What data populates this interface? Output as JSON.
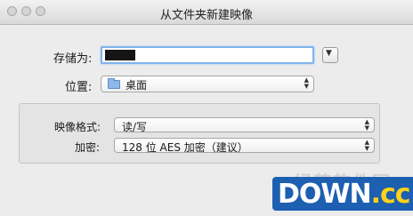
{
  "window": {
    "title": "从文件夹新建映像"
  },
  "save_as": {
    "label": "存储为:",
    "value": ""
  },
  "location": {
    "label": "位置:",
    "value": "桌面"
  },
  "image_format": {
    "label": "映像格式:",
    "value": "读/写"
  },
  "encryption": {
    "label": "加密:",
    "value": "128 位 AES 加密（建议）"
  },
  "watermark": {
    "cn": "绿茶软件园",
    "brand": "DOWN",
    "suffix": ".cc"
  },
  "icons": {
    "close": "close-icon",
    "minimize": "minimize-icon",
    "zoom": "zoom-icon",
    "expand": "triangle-down-icon",
    "folder": "folder-icon",
    "popup_arrows": "updown-arrows-icon"
  }
}
